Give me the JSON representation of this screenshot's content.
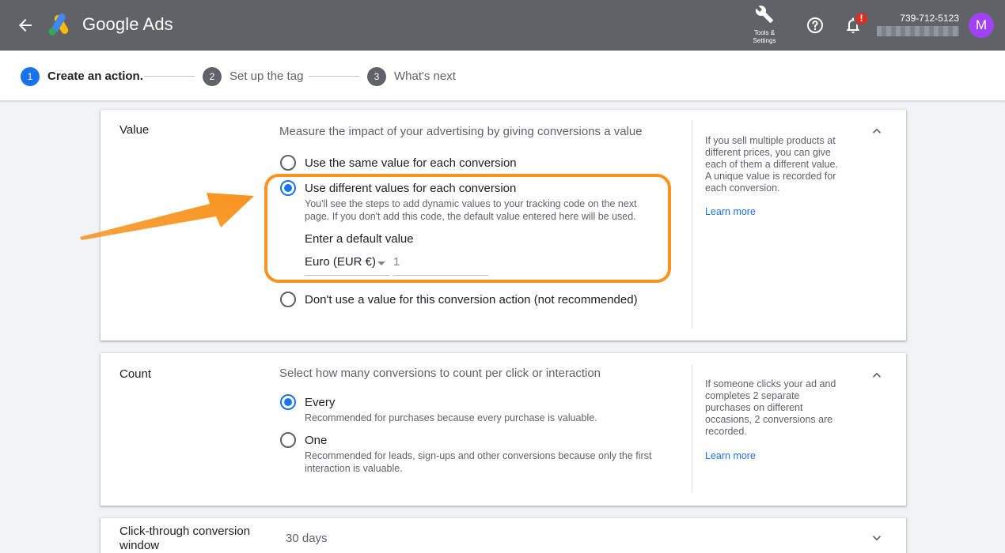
{
  "header": {
    "brand": "Google Ads",
    "tools_label_line1": "Tools &",
    "tools_label_line2": "Settings",
    "notification_badge": "!",
    "account_id": "739-712-5123",
    "avatar_initial": "M"
  },
  "stepper": {
    "steps": [
      {
        "number": "1",
        "label": "Create an action."
      },
      {
        "number": "2",
        "label": "Set up the tag"
      },
      {
        "number": "3",
        "label": "What's next"
      }
    ]
  },
  "value_section": {
    "title": "Value",
    "description": "Measure the impact of your advertising by giving conversions a value",
    "options": [
      {
        "label": "Use the same value for each conversion",
        "selected": false
      },
      {
        "label": "Use different values for each conversion",
        "selected": true,
        "sub_line1": "You'll see the steps to add dynamic values to your tracking code on the next",
        "sub_line2": "page. If you don't add this code, the default value entered here will be used."
      },
      {
        "label": "Don't use a value for this conversion action (not recommended)",
        "selected": false
      }
    ],
    "default_value_label": "Enter a default value",
    "currency": "Euro (EUR €)",
    "default_value": "1",
    "help_lines": [
      "If you sell multiple products at",
      "different prices, you can give",
      "each of them a different value.",
      "A unique value is recorded for",
      "each conversion."
    ],
    "learn_more": "Learn more"
  },
  "count_section": {
    "title": "Count",
    "description": "Select how many conversions to count per click or interaction",
    "options": [
      {
        "label": "Every",
        "selected": true,
        "sub_line1": "Recommended for purchases because every purchase is valuable."
      },
      {
        "label": "One",
        "selected": false,
        "sub_line1": "Recommended for leads, sign-ups and other conversions because only the first",
        "sub_line2": "interaction is valuable."
      }
    ],
    "help_lines": [
      "If someone clicks your ad and",
      "completes 2 separate",
      "purchases on different",
      "occasions, 2 conversions are",
      "recorded."
    ],
    "learn_more": "Learn more"
  },
  "click_through_section": {
    "title_line1": "Click-through conversion",
    "title_line2": "window",
    "value": "30 days"
  },
  "colors": {
    "header_bg": "#5f6368",
    "accent_blue": "#1a73e8",
    "highlight_orange": "#f7931e",
    "avatar_purple": "#a142f4"
  }
}
